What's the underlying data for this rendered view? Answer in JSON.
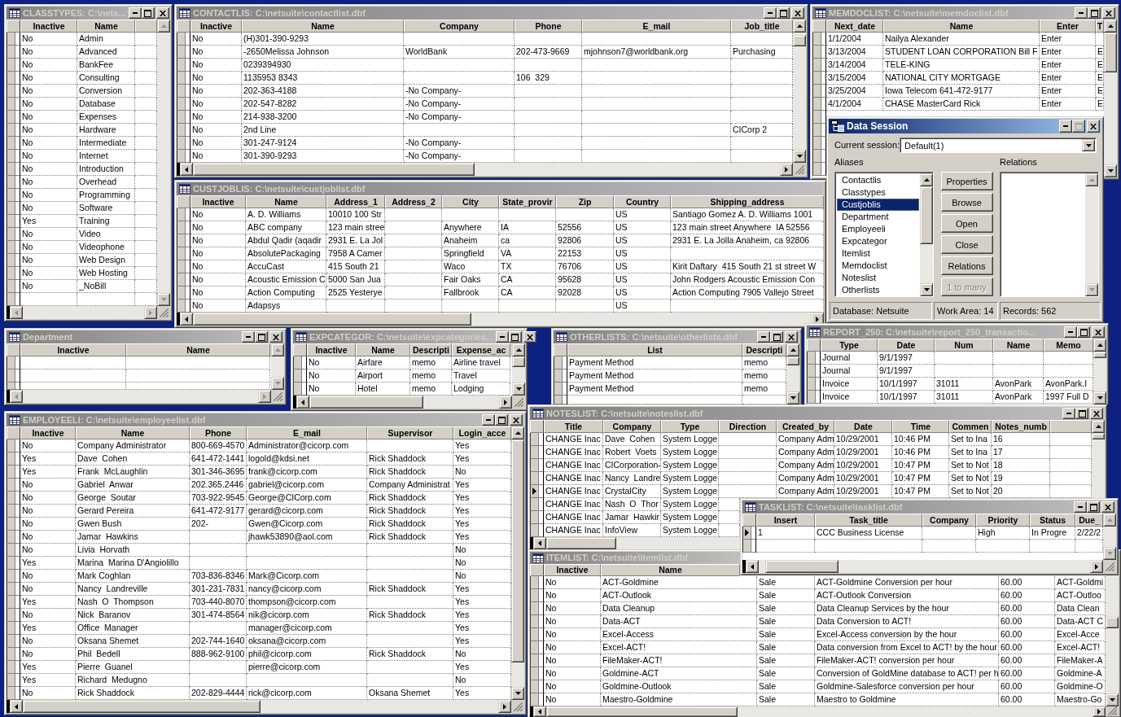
{
  "windows": [
    {
      "kind": "grid",
      "title": "CLASSTYPES: C:\\nets...",
      "active": false,
      "columns": [
        "Inactive",
        "Name"
      ],
      "rows": [
        [
          "No",
          "Admin"
        ],
        [
          "No",
          "Advanced"
        ],
        [
          "No",
          "BankFee"
        ],
        [
          "No",
          "Consulting"
        ],
        [
          "No",
          "Conversion"
        ],
        [
          "No",
          "Database"
        ],
        [
          "No",
          "Expenses"
        ],
        [
          "No",
          "Hardware"
        ],
        [
          "No",
          "Intermediate"
        ],
        [
          "No",
          "Internet"
        ],
        [
          "No",
          "Introduction"
        ],
        [
          "No",
          "Overhead"
        ],
        [
          "No",
          "Programming"
        ],
        [
          "No",
          "Software"
        ],
        [
          "Yes",
          "Training"
        ],
        [
          "No",
          "Video"
        ],
        [
          "No",
          "Videophone"
        ],
        [
          "No",
          "Web Design"
        ],
        [
          "No",
          "Web Hosting"
        ],
        [
          "No",
          "_NoBill"
        ]
      ]
    },
    {
      "kind": "grid",
      "title": "CONTACTLIS: C:\\netsuite\\contactlist.dbf",
      "active": false,
      "columns": [
        "Inactive",
        "Name",
        "Company",
        "Phone",
        "E_mail",
        "Job_title"
      ],
      "rows": [
        [
          "No",
          "(H)301-390-9293"
        ],
        [
          "No",
          "-2650Melissa Johnson",
          "WorldBank",
          "202-473-9669",
          "mjohnson7@worldbank.org",
          "Purchasing"
        ],
        [
          "No",
          "0239394930"
        ],
        [
          "No",
          "1135953 8343",
          null,
          "106  329"
        ],
        [
          "No",
          "202-363-4188",
          "-No Company-"
        ],
        [
          "No",
          "202-547-8282",
          "-No Company-"
        ],
        [
          "No",
          "214-938-3200",
          "-No Company-"
        ],
        [
          "No",
          "2nd Line",
          null,
          null,
          null,
          "CICorp 2"
        ],
        [
          "No",
          "301-247-9124",
          "-No Company-"
        ],
        [
          "No",
          "301-390-9293",
          "-No Company-"
        ]
      ]
    },
    {
      "kind": "grid",
      "title": "MEMDOCLIST: C:\\netsuite\\memdoclist.dbf",
      "active": false,
      "columns": [
        "Next_date",
        "Name",
        "Enter",
        "T"
      ],
      "rows": [
        [
          "1/1/2004",
          "Nailya Alexander",
          "Enter"
        ],
        [
          "3/13/2004",
          "STUDENT LOAN CORPORATION Bill F",
          "Enter",
          "E"
        ],
        [
          "3/14/2004",
          "TELE-KING",
          "Enter",
          "E"
        ],
        [
          "3/15/2004",
          "NATIONAL CITY MORTGAGE",
          "Enter",
          "E"
        ],
        [
          "3/25/2004",
          "Iowa Telecom 641-472-9177",
          "Enter",
          "E"
        ],
        [
          "4/1/2004",
          "CHASE MasterCard Rick",
          "Enter",
          "E"
        ]
      ]
    },
    {
      "kind": "grid",
      "title": "CUSTJOBLIS: C:\\netsuite\\custjoblist.dbf",
      "active": false,
      "columns": [
        "Inactive",
        "Name",
        "Address_1",
        "Address_2",
        "City",
        "State_provir",
        "Zip",
        "Country",
        "Shipping_address"
      ],
      "rows": [
        [
          "No",
          "A. D. Williams",
          "10010 100 Str",
          null,
          null,
          null,
          null,
          "US",
          "Santiago Gomez A. D. Williams 1001"
        ],
        [
          "No",
          "ABC company",
          "123 main stree",
          null,
          "Anywhere",
          "IA",
          "52556",
          "US",
          "123 main street Anywhere  IA 52556"
        ],
        [
          "No",
          "Abdul Qadir (aqadir",
          "2931 E. La Jol",
          null,
          "Anaheim",
          "ca",
          "92806",
          "US",
          "2931 E. La Jolla Anaheim, ca 92806"
        ],
        [
          "No",
          "AbsolutePackaging",
          "7958 A Camer",
          null,
          "Springfield",
          "VA",
          "22153",
          "US"
        ],
        [
          "No",
          "AccuCast",
          "415 South 21",
          null,
          "Waco",
          "TX",
          "76706",
          "US",
          "Kirit Daftary  415 South 21 st street W"
        ],
        [
          "No",
          "Acoustic Emission C",
          "5000 San Jua",
          null,
          "Fair Oaks",
          "CA",
          "95628",
          "US",
          "John Rodgers Acoustic Emission Con"
        ],
        [
          "No",
          "Action Computing",
          "2525 Yesterye",
          null,
          "Fallbrook",
          "CA",
          "92028",
          "US",
          "Action Computing 7905 Vallejo Street"
        ],
        [
          "No",
          "Adapsys",
          null,
          null,
          null,
          null,
          null,
          "US"
        ]
      ]
    },
    {
      "kind": "dialog",
      "title": "Data Session",
      "active": true,
      "maximize_disabled": true,
      "session": {
        "label": "Current session:",
        "value": "Default(1)"
      },
      "aliases": {
        "label": "Aliases",
        "items": [
          {
            "label": "Contactlis",
            "selected": false
          },
          {
            "label": "Classtypes",
            "selected": false
          },
          {
            "label": "Custjoblis",
            "selected": true
          },
          {
            "label": "Department",
            "selected": false
          },
          {
            "label": "Employeeli",
            "selected": false
          },
          {
            "label": "Expcategor",
            "selected": false
          },
          {
            "label": "Itemlist",
            "selected": false
          },
          {
            "label": "Memdoclist",
            "selected": false
          },
          {
            "label": "Noteslist",
            "selected": false
          },
          {
            "label": "Otherlists",
            "selected": false
          }
        ]
      },
      "relations": {
        "label": "Relations"
      },
      "buttons": [
        {
          "label": "Properties",
          "disabled": false
        },
        {
          "label": "Browse",
          "disabled": false
        },
        {
          "label": "Open",
          "disabled": false
        },
        {
          "label": "Close",
          "disabled": false
        },
        {
          "label": "Relations",
          "disabled": false
        },
        {
          "label": "1 to many",
          "disabled": true
        }
      ],
      "status_bar": [
        "Database: Netsuite",
        "Work Area: 14",
        "Records: 562"
      ]
    },
    {
      "kind": "grid",
      "title": "Department",
      "active": false,
      "columns": [
        "Inactive",
        "Name"
      ]
    },
    {
      "kind": "grid",
      "title": "EXPCATEGOR: C:\\netsuite\\expcategories...",
      "active": false,
      "columns": [
        "Inactive",
        "Name",
        "Descripti",
        "Expense_ac"
      ],
      "rows": [
        [
          "No",
          "Airfare",
          "memo",
          "Airline travel"
        ],
        [
          "No",
          "Airport",
          "memo",
          "Travel"
        ],
        [
          "No",
          "Hotel",
          "memo",
          "Lodging"
        ]
      ]
    },
    {
      "kind": "grid",
      "title": "OTHERLISTS: C:\\netsuite\\otherlists.dbf",
      "active": false,
      "columns": [
        "List",
        "Descripti"
      ],
      "rows": [
        [
          "Payment Method",
          "memo"
        ],
        [
          "Payment Method",
          "memo"
        ],
        [
          "Payment Method",
          "memo"
        ]
      ]
    },
    {
      "kind": "grid",
      "title": "REPORT_250: C:\\netsuite\\report_250_transactio...",
      "active": false,
      "columns": [
        "Type",
        "Date",
        "Num",
        "Name",
        "Memo"
      ],
      "rows": [
        [
          "Journal",
          "9/1/1997"
        ],
        [
          "Journal",
          "9/1/1997"
        ],
        [
          "Invoice",
          "10/1/1997",
          "31011",
          "AvonPark",
          "AvonPark.I"
        ],
        [
          "Invoice",
          "10/1/1997",
          "31011",
          "AvonPark",
          "1997 Full D"
        ]
      ]
    },
    {
      "kind": "grid",
      "title": "EMPLOYEELI: C:\\netsuite\\employeelist.dbf",
      "active": false,
      "columns": [
        "Inactive",
        "Name",
        "Phone",
        "E_mail",
        "Supervisor",
        "Login_acce"
      ],
      "rows": [
        [
          "No",
          "Company Administrator",
          "800-669-4570",
          "Administrator@cicorp.com",
          null,
          "Yes"
        ],
        [
          "Yes",
          "Dave  Cohen",
          "641-472-1441",
          "logold@kdsi.net",
          "Rick Shaddock",
          "Yes"
        ],
        [
          "Yes",
          "Frank  McLaughlin",
          "301-346-3695",
          "frank@cicorp.com",
          "Rick Shaddock",
          "No"
        ],
        [
          "No",
          "Gabriel  Anwar",
          "202.365.2446",
          "gabriel@cicorp.com",
          "Company Administrat",
          "Yes"
        ],
        [
          "No",
          "George  Soutar",
          "703-922-9545",
          "George@CICorp.com",
          "Rick Shaddock",
          "Yes"
        ],
        [
          "No",
          "Gerard Pereira",
          "641-472-9177",
          "gerard@cicorp.com",
          "Rick Shaddock",
          "Yes"
        ],
        [
          "No",
          "Gwen Bush",
          "202-",
          "Gwen@Cicorp.com",
          "Rick Shaddock",
          "Yes"
        ],
        [
          "No",
          "Jamar  Hawkins",
          null,
          "jhawk53890@aol.com",
          "Rick Shaddock",
          "Yes"
        ],
        [
          "No",
          "Livia  Horvath",
          null,
          null,
          null,
          "No"
        ],
        [
          "Yes",
          "Marina  Marina D'Angiolillo",
          null,
          null,
          null,
          "No"
        ],
        [
          "No",
          "Mark Coghlan",
          "703-836-8346",
          "Mark@Cicorp.com",
          null,
          "No"
        ],
        [
          "No",
          "Nancy  Landreville",
          "301-231-7831",
          "nancy@cicorp.com",
          "Rick Shaddock",
          "Yes"
        ],
        [
          "Yes",
          "Nash  O  Thompson",
          "703-440-8070",
          "thompson@cicorp.com",
          null,
          "Yes"
        ],
        [
          "No",
          "Nick  Baranov",
          "301-474-8564",
          "nik@cicorp.com",
          "Rick Shaddock",
          "Yes"
        ],
        [
          "Yes",
          "Office  Manager",
          null,
          "manager@cicorp.com",
          null,
          "Yes"
        ],
        [
          "No",
          "Oksana Shemet",
          "202-744-1640",
          "oksana@cicorp.com",
          null,
          "Yes"
        ],
        [
          "No",
          "Phil  Bedell",
          "888-962-9100",
          "phil@cicorp.com",
          "Rick Shaddock",
          "No"
        ],
        [
          "Yes",
          "Pierre  Guanel",
          null,
          "pierre@cicorp.com",
          null,
          "Yes"
        ],
        [
          "Yes",
          "Richard  Medugno",
          null,
          null,
          null,
          "No"
        ],
        [
          "No",
          "Rick Shaddock",
          "202-829-4444",
          "rick@cicorp.com",
          "Oksana Shemet",
          "Yes"
        ]
      ]
    },
    {
      "kind": "grid",
      "title": "NOTESLIST: C:\\netsuite\\noteslist.dbf",
      "active": false,
      "columns": [
        "Title",
        "Company",
        "Type",
        "Direction",
        "Created_by",
        "Date",
        "Time",
        "Commen",
        "Notes_numb"
      ],
      "rows": [
        {
          "selected": false,
          "cells": [
            "CHANGE Inac",
            "Dave  Cohen",
            "System Logge",
            null,
            "Company Adm",
            "10/29/2001",
            "10:46 PM",
            "Set to Ina",
            "16"
          ]
        },
        {
          "selected": false,
          "cells": [
            "CHANGE Inac",
            "Robert  Voets",
            "System Logge",
            null,
            "Company Adm",
            "10/29/2001",
            "10:46 PM",
            "Set to Ina",
            "17"
          ]
        },
        {
          "selected": false,
          "cells": [
            "CHANGE Inac",
            "CICorporation-",
            "System Logge",
            null,
            "Company Adm",
            "10/29/2001",
            "10:47 PM",
            "Set to Not",
            "18"
          ]
        },
        {
          "selected": false,
          "cells": [
            "CHANGE Inac",
            "Nancy  Landre",
            "System Logge",
            null,
            "Company Adm",
            "10/29/2001",
            "10:47 PM",
            "Set to Not",
            "19"
          ]
        },
        {
          "selected": true,
          "cells": [
            "CHANGE Inac",
            "CrystalCity",
            "System Logge",
            null,
            "Company Adm",
            "10/29/2001",
            "10:47 PM",
            "Set to Not",
            "20"
          ]
        },
        {
          "selected": false,
          "cells": [
            "CHANGE Inac",
            "Nash  O  Thor",
            "System Logge"
          ]
        },
        {
          "selected": false,
          "cells": [
            "CHANGE Inac",
            "Jamar  Hawkir",
            "System Logge"
          ]
        },
        {
          "selected": false,
          "cells": [
            "CHANGE Inac",
            "InfoView",
            "System Logge"
          ]
        }
      ]
    },
    {
      "kind": "grid",
      "title": "TASKLIST: C:\\netsuite\\tasklist.dbf",
      "active": false,
      "columns": [
        "Insert",
        "Task_title",
        "Company",
        "Priority",
        "Status",
        "Due_"
      ],
      "rows": [
        {
          "selected": true,
          "cells": [
            "1",
            "CCC Business License",
            null,
            "High",
            "In Progre",
            "2/22/2"
          ]
        }
      ]
    },
    {
      "kind": "grid",
      "title": "ITEMLIST: C:\\netsuite\\itemlist.dbf",
      "active": false,
      "columns": [
        "Inactive",
        "Name"
      ],
      "rows": [
        [
          "No",
          "ACT-Goldmine",
          "Sale",
          "ACT-Goldmine Conversion per hour",
          "60.00",
          "ACT-Goldmi"
        ],
        [
          "No",
          "ACT-Outlook",
          "Sale",
          "ACT-Outlook Conversion",
          "60.00",
          "ACT-Outloo"
        ],
        [
          "No",
          "Data Cleanup",
          "Sale",
          "Data Cleanup Services by the hour",
          "60.00",
          "Data Clean"
        ],
        [
          "No",
          "Data-ACT",
          "Sale",
          "Data Conversion to ACT!",
          "60.00",
          "Data-ACT C"
        ],
        [
          "No",
          "Excel-Access",
          "Sale",
          "Excel-Access conversion by the hour",
          "60.00",
          "Excel-Acce"
        ],
        [
          "No",
          "Excel-ACT!",
          "Sale",
          "Data conversion from Excel to ACT! by the hour",
          "60.00",
          "Excel-ACT!"
        ],
        [
          "No",
          "FileMaker-ACT!",
          "Sale",
          "FileMaker-ACT! conversion per hour",
          "60.00",
          "FileMaker-A"
        ],
        [
          "No",
          "Goldmine-ACT",
          "Sale",
          "Conversion of GoldMine database to ACT! per h",
          "60.00",
          "Goldmine-A"
        ],
        [
          "No",
          "Goldmine-Outlook",
          "Sale",
          "Goldmine-Salesforce conversion per hour",
          "60.00",
          "Goldmine-O"
        ],
        [
          "No",
          "Maestro-Goldmine",
          "Sale",
          "Maestro to Goldmine",
          "60.00",
          "Maestro-Go"
        ]
      ]
    }
  ]
}
